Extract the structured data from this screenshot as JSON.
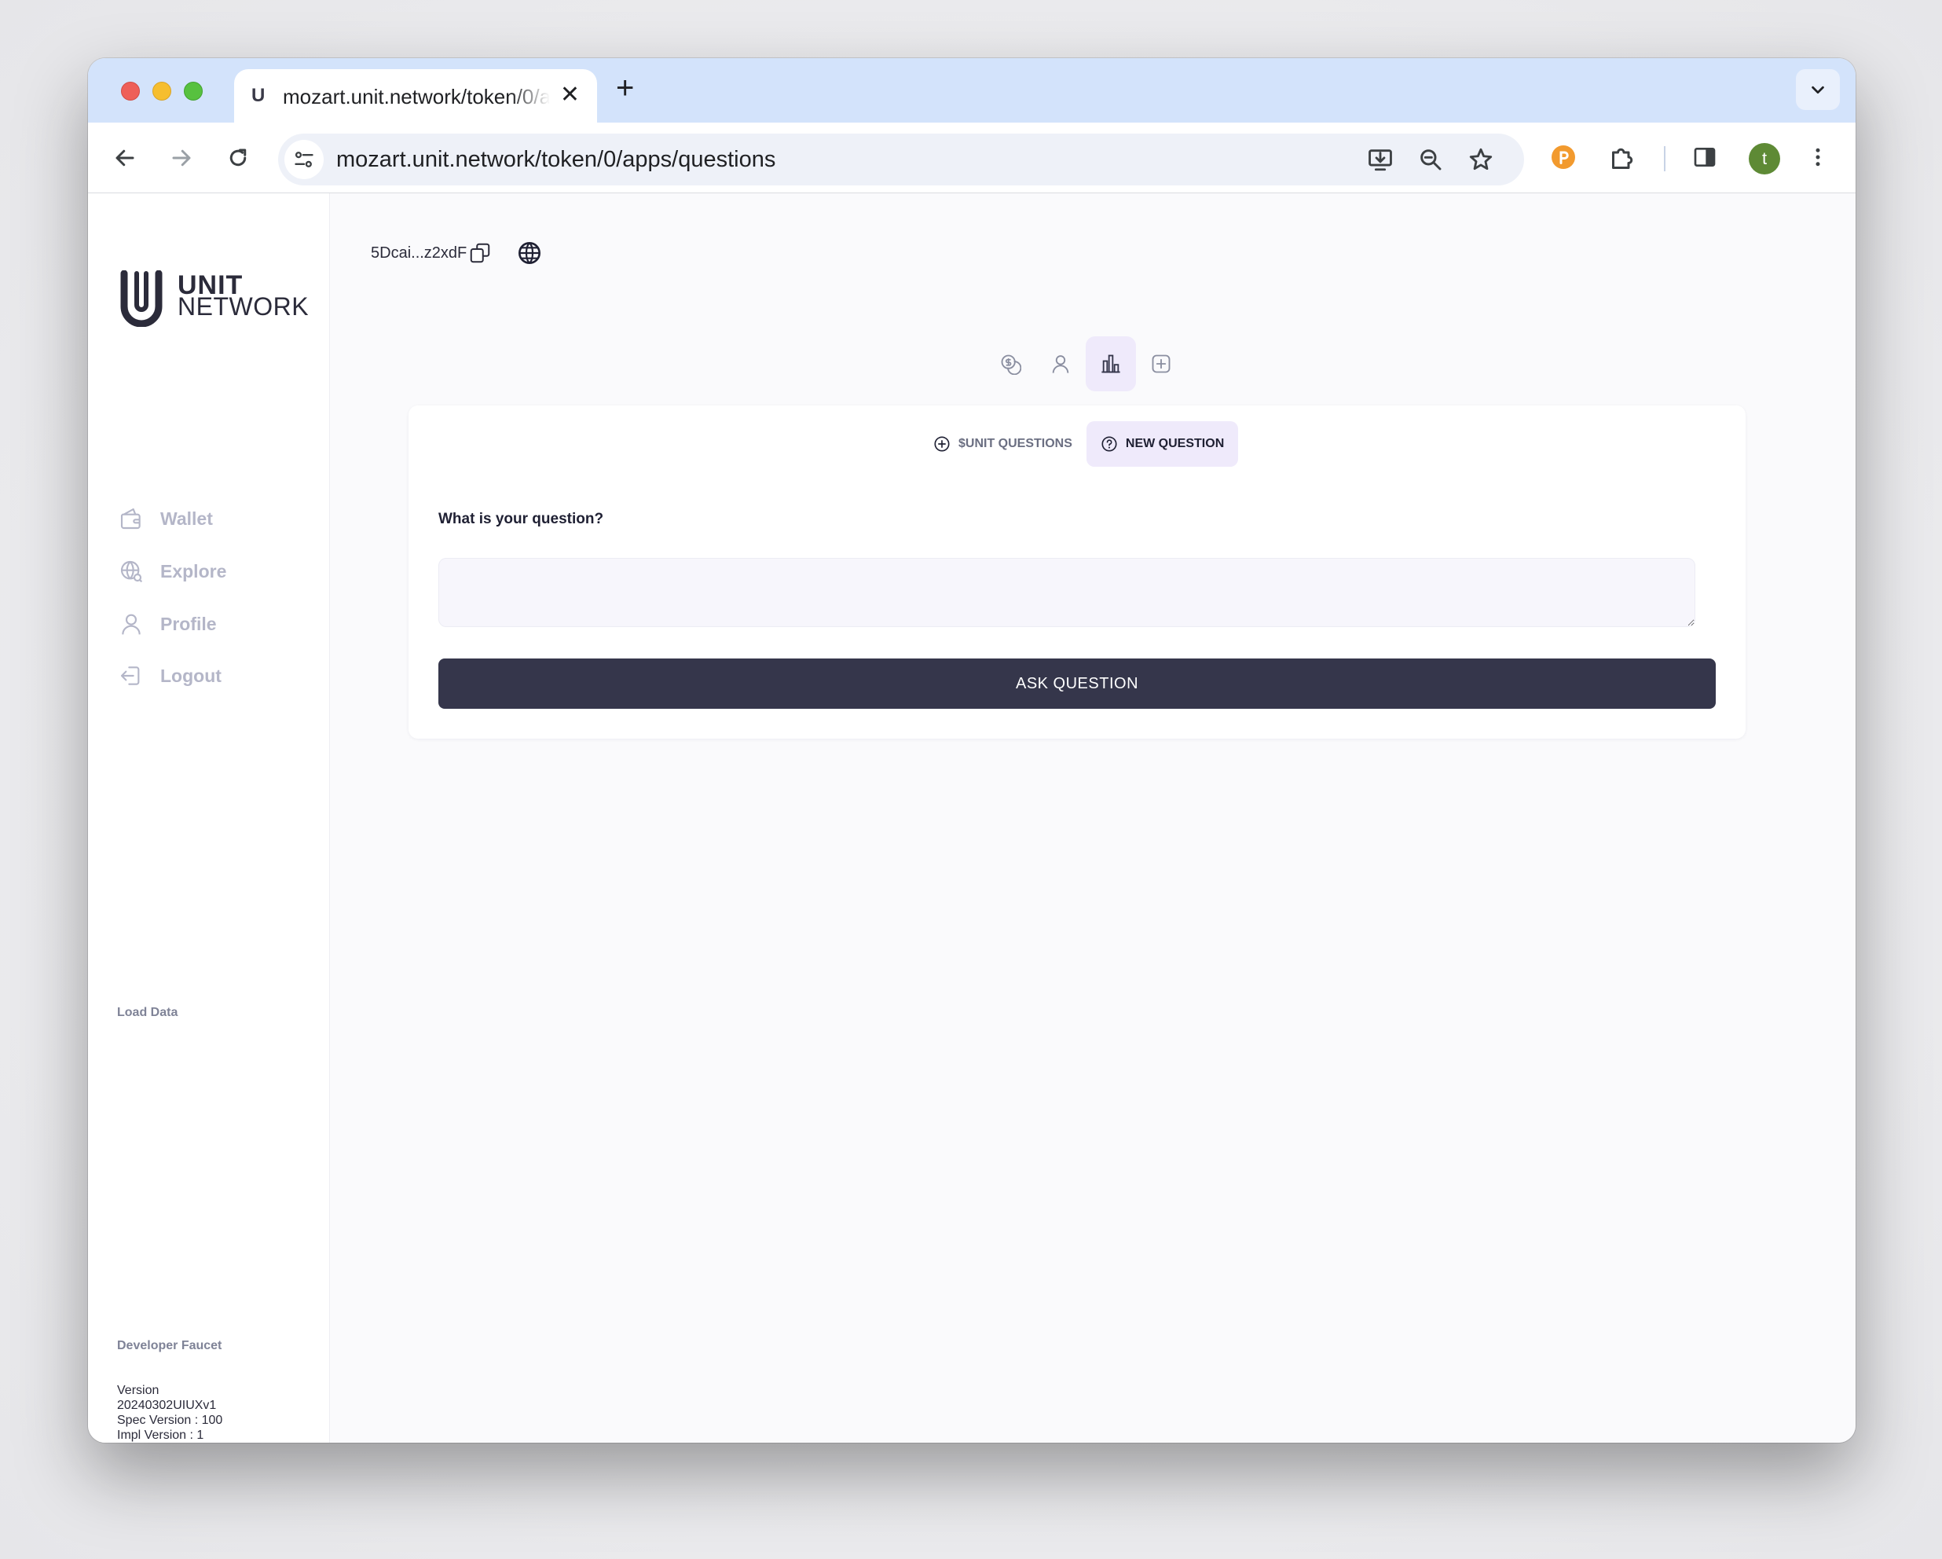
{
  "browser": {
    "tab_title": "mozart.unit.network/token/0/apps/questions",
    "tab_favicon": "U",
    "url": "mozart.unit.network/token/0/apps/questions",
    "profile_initial": "t"
  },
  "sidebar": {
    "logo_top": "UNIT",
    "logo_bottom": "NETWORK",
    "items": [
      {
        "label": "Wallet",
        "icon": "wallet-icon"
      },
      {
        "label": "Explore",
        "icon": "globe-search-icon"
      },
      {
        "label": "Profile",
        "icon": "user-icon"
      },
      {
        "label": "Logout",
        "icon": "logout-icon"
      }
    ],
    "load_data": "Load Data",
    "developer_faucet": "Developer Faucet",
    "version_lines": [
      "Version",
      "20240302UIUXv1",
      "Spec Version : 100",
      "Impl Version : 1"
    ]
  },
  "main": {
    "address": "5Dcai...z2xdF",
    "icon_tabs": [
      "coins-icon",
      "user-icon",
      "bar-chart-icon",
      "plus-square-icon"
    ],
    "active_icon_tab": "bar-chart-icon",
    "subtabs": [
      {
        "label": "$UNIT QUESTIONS",
        "active": false
      },
      {
        "label": "NEW QUESTION",
        "active": true
      }
    ],
    "question_label": "What is your question?",
    "question_value": "",
    "ask_button": "ASK QUESTION"
  },
  "colors": {
    "accent_dark": "#35364b",
    "active_bg": "#efeafb",
    "sidebar_text": "#b4b6c8"
  }
}
